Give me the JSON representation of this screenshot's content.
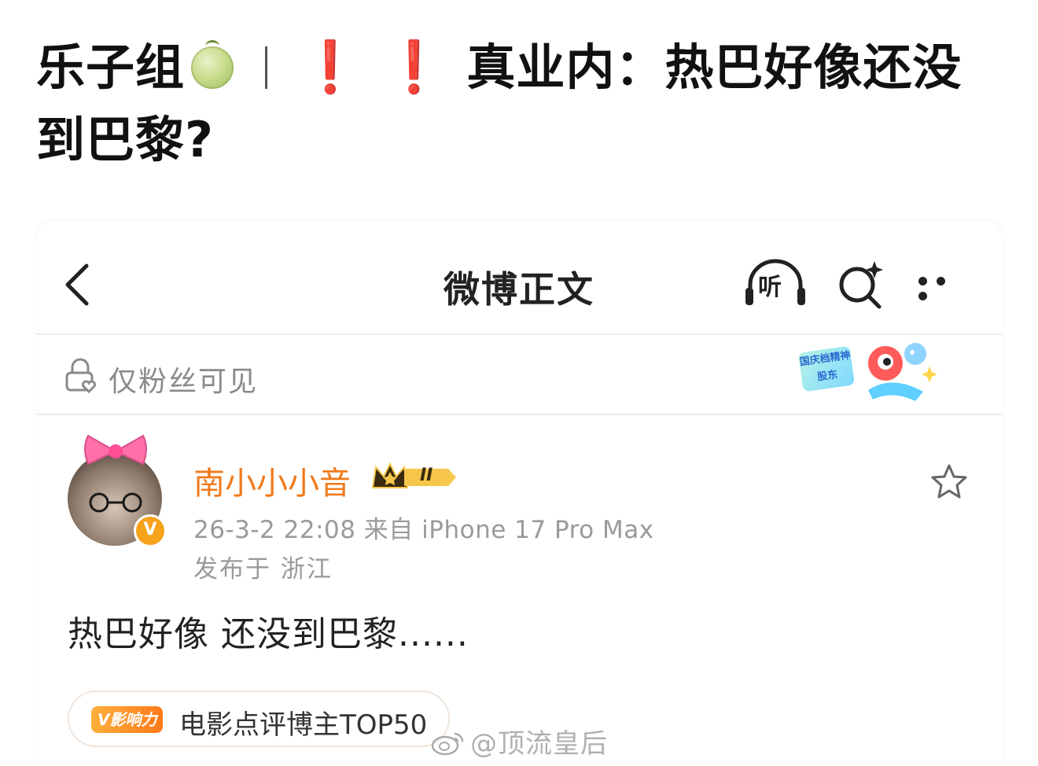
{
  "headline": {
    "prefix": "乐子组",
    "melon_icon": "melon-emoji",
    "separator": "|",
    "exclamation_1": "❗",
    "exclamation_2": "❗",
    "title": "真业内：热巴好像还没到巴黎?"
  },
  "navbar": {
    "title": "微博正文",
    "listen_label": "听",
    "back_icon": "chevron-left-icon",
    "search_icon": "search-sparkle-icon",
    "more_icon": "more-dots-icon"
  },
  "privacy": {
    "text": "仅粉丝可见",
    "icon": "lock-heart-icon",
    "promo_badge_text": "国庆档精神股东"
  },
  "author": {
    "name": "南小小小音",
    "vip_level": "II",
    "verified_mark": "V",
    "meta": "26-3-2 22:08  来自 iPhone 17 Pro Max",
    "location": "发布于 浙江"
  },
  "post": {
    "body": "热巴好像 还没到巴黎......"
  },
  "influence": {
    "tag": "V影响力",
    "text": "电影点评博主TOP50"
  },
  "watermark": {
    "text": "@顶流皇后"
  },
  "colors": {
    "accent_orange": "#f07a1a",
    "exclamation_red": "#e01b24",
    "muted_gray": "#9a9a9a"
  }
}
